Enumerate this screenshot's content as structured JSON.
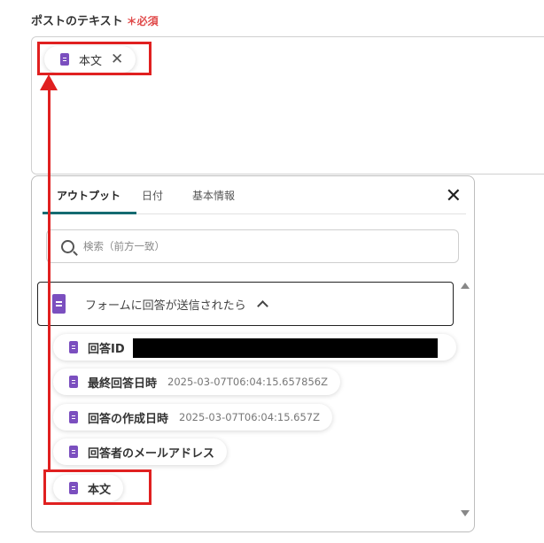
{
  "field": {
    "label": "ポストのテキスト",
    "required": "＊必須"
  },
  "selected_chip": {
    "label": "本文",
    "remove_glyph": "✕"
  },
  "panel": {
    "tabs": [
      {
        "label": "アウトプット",
        "active": true
      },
      {
        "label": "日付",
        "active": false
      },
      {
        "label": "基本情報",
        "active": false
      }
    ],
    "close_glyph": "✕",
    "search_placeholder": "検索（前方一致）",
    "group_label": "フォームに回答が送信されたら",
    "items": [
      {
        "label": "回答ID",
        "value": ""
      },
      {
        "label": "最終回答日時",
        "value": "2025-03-07T06:04:15.657856Z"
      },
      {
        "label": "回答の作成日時",
        "value": "2025-03-07T06:04:15.657Z"
      },
      {
        "label": "回答者のメールアドレス",
        "value": ""
      },
      {
        "label": "本文",
        "value": ""
      }
    ]
  },
  "colors": {
    "annotation": "#e02020",
    "doc_icon": "#7b4fbf",
    "tab_underline": "#146b71",
    "required": "#e04a4a"
  },
  "icons": [
    "document-icon",
    "search-icon",
    "close-icon",
    "chevron-up-icon",
    "remove-icon"
  ]
}
